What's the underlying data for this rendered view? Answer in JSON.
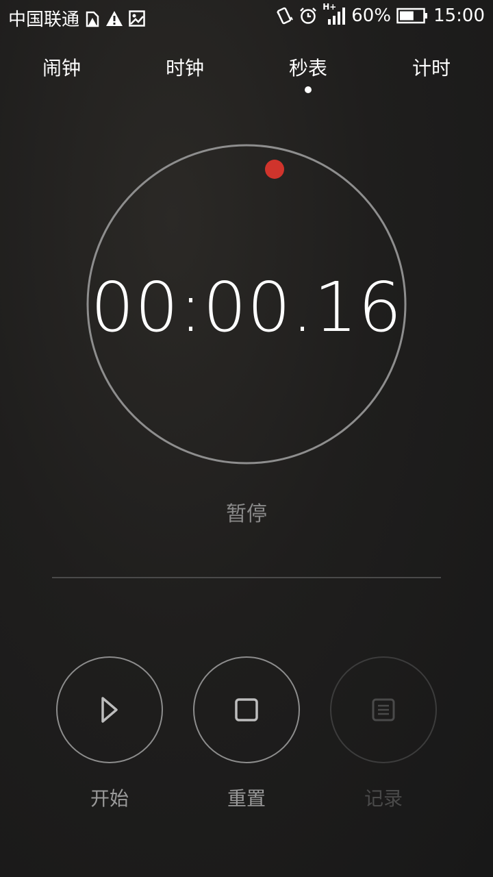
{
  "status_bar": {
    "carrier": "中国联通",
    "battery_percent": "60%",
    "clock": "15:00",
    "network_label": "H+",
    "battery_level": 0.6,
    "icons_left": [
      "sim-warning-icon",
      "warning-icon",
      "image-icon"
    ],
    "icons_right": [
      "vibrate-icon",
      "alarm-icon",
      "signal-icon",
      "battery-icon"
    ]
  },
  "tabs": [
    {
      "label": "闹钟",
      "active": false
    },
    {
      "label": "时钟",
      "active": false
    },
    {
      "label": "秒表",
      "active": true
    },
    {
      "label": "计时",
      "active": false
    }
  ],
  "stopwatch": {
    "time": "00:00.16",
    "state": "暂停"
  },
  "controls": {
    "start_label": "开始",
    "reset_label": "重置",
    "lap_label": "记录"
  },
  "colors": {
    "accent_dot": "#d0342c",
    "dial_ring": "#8e8e8e"
  }
}
